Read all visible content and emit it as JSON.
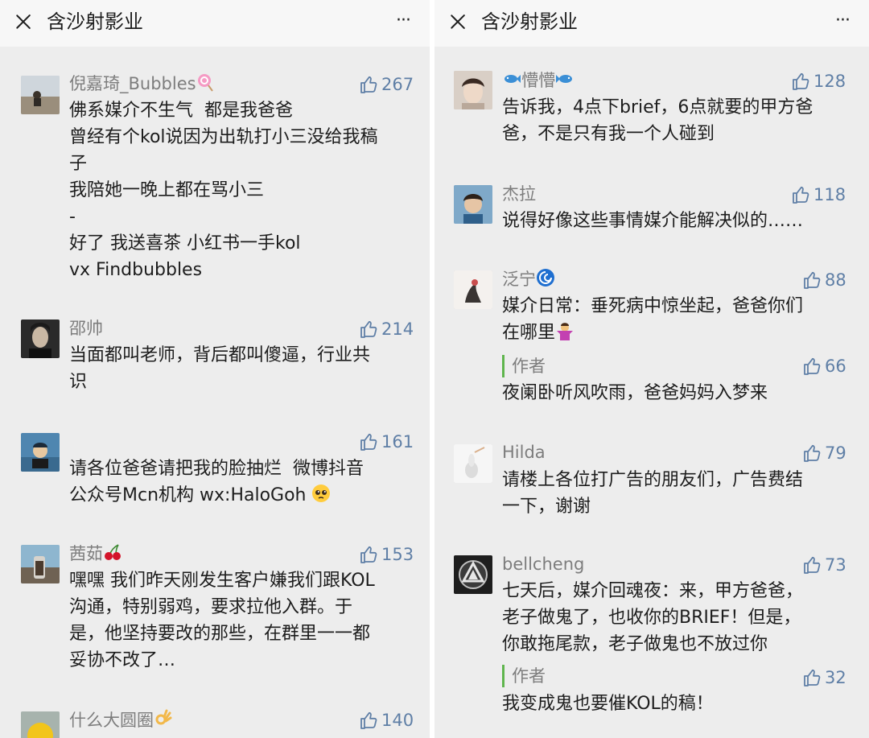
{
  "left": {
    "header": {
      "title": "含沙射影业",
      "more": "···"
    },
    "comments": [
      {
        "user": "倪嘉琦_Bubbles",
        "likes": "267",
        "text": "佛系媒介不生气  都是我爸爸\n曾经有个kol说因为出轨打小三没给我稿\n子\n我陪她一晚上都在骂小三\n-\n好了 我送喜茶 小红书一手kol\nvx Findbubbles"
      },
      {
        "user": "邵帅",
        "likes": "214",
        "text": "当面都叫老师，背后都叫傻逼，行业共\n识"
      },
      {
        "user": "",
        "likes": "161",
        "text": "请各位爸爸请把我的脸抽烂  微博抖音\n公众号Mcn机构 wx:HaloGoh "
      },
      {
        "user": "茜茹",
        "likes": "153",
        "text": "嘿嘿 我们昨天刚发生客户嫌我们跟KOL\n沟通，特别弱鸡，要求拉他入群。于\n是，他坚持要改的那些，在群里一一都\n妥协不改了…"
      },
      {
        "user": "什么大圆圈",
        "likes": "140",
        "text": ""
      }
    ]
  },
  "right": {
    "header": {
      "title": "含沙射影业",
      "more": "···"
    },
    "comments": [
      {
        "user": "懵懵",
        "likes": "128",
        "text": "告诉我，4点下brief，6点就要的甲方爸\n爸，不是只有我一个人碰到"
      },
      {
        "user": "杰拉",
        "likes": "118",
        "text": "说得好像这些事情媒介能解决似的……"
      },
      {
        "user": "泛宁",
        "likes": "88",
        "text": "媒介日常：垂死病中惊坐起，爸爸你们\n在哪里"
      },
      {
        "user": "作者",
        "likes": "66",
        "text": "夜阑卧听风吹雨，爸爸妈妈入梦来"
      },
      {
        "user": "Hilda",
        "likes": "79",
        "text": "请楼上各位打广告的朋友们，广告费结\n一下，谢谢"
      },
      {
        "user": "bellcheng",
        "likes": "73",
        "text": "七天后，媒介回魂夜：来，甲方爸爸，\n老子做鬼了，也收你的BRIEF！但是，\n你敢拖尾款，老子做鬼也不放过你"
      },
      {
        "user": "作者",
        "likes": "32",
        "text": "我变成鬼也要催KOL的稿！"
      }
    ]
  },
  "colors": {
    "accent": "#5f7fa6",
    "author_bar": "#5fb54d",
    "panel_bg": "#ededed",
    "header_bg": "#f7f7f7"
  }
}
